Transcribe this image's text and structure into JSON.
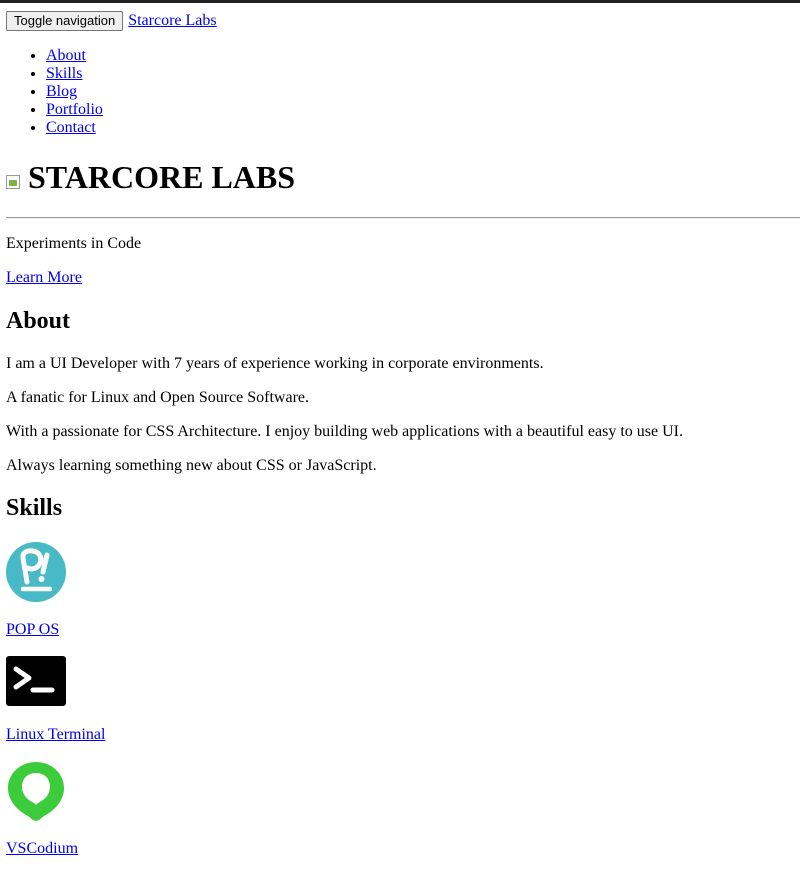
{
  "navbar": {
    "toggle_label": "Toggle navigation",
    "brand": "Starcore Labs",
    "items": [
      {
        "label": "About"
      },
      {
        "label": "Skills"
      },
      {
        "label": "Blog"
      },
      {
        "label": "Portfolio"
      },
      {
        "label": "Contact"
      }
    ]
  },
  "hero": {
    "logo_icon": "broken-image-icon",
    "title": "STARCORE LABS",
    "tagline": "Experiments in Code",
    "cta": "Learn More"
  },
  "about": {
    "heading": "About",
    "paragraphs": [
      "I am a UI Developer with 7 years of experience working in corporate environments.",
      "A fanatic for Linux and Open Source Software.",
      "With a passionate for CSS Architecture. I enjoy building web applications with a beautiful easy to use UI.",
      "Always learning something new about CSS or JavaScript."
    ]
  },
  "skills": {
    "heading": "Skills",
    "items": [
      {
        "label": "POP OS",
        "icon": "pop-os-icon",
        "color": "#48B9C7"
      },
      {
        "label": "Linux Terminal",
        "icon": "terminal-icon",
        "color": "#000000"
      },
      {
        "label": "VSCodium",
        "icon": "vscodium-icon",
        "color": "#3BCB3B"
      }
    ]
  }
}
